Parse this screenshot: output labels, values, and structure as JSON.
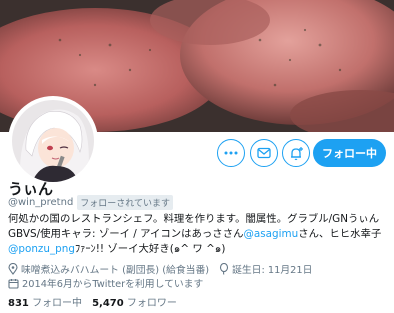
{
  "profile": {
    "display_name": "うぃん",
    "handle": "@win_pretnd",
    "follows_you_badge": "フォローされています",
    "follow_button_label": "フォロー中",
    "bio": {
      "line1": "何処かの国のレストランシェフ。料理を作ります。闇属性。グラブル/GNうぃん",
      "line2_pre": "GBVS/使用キャラ: ゾーイ / アイコンはあっささん",
      "line2_link": "@asagimu",
      "line2_post": "さん、ヒヒ水幸子",
      "line3_link": "@ponzu_png",
      "line3_post": "ﾌｧｰﾝ!! ゾーイ大好き(๑^ ワ ^๑)"
    },
    "location": "味噌煮込みバハムート (副団長) (給食当番)",
    "birthday": "誕生日: 11月21日",
    "joined": "2014年6月からTwitterを利用しています",
    "following_count": "831",
    "following_label": "フォロー中",
    "followers_count": "5,470",
    "followers_label": "フォロワー"
  },
  "icons": {
    "more": "more-dots-icon",
    "message": "envelope-icon",
    "notify": "bell-plus-icon",
    "location": "location-pin-icon",
    "birthday": "balloon-icon",
    "joined": "calendar-icon"
  },
  "colors": {
    "accent": "#1da1f2",
    "muted": "#657786",
    "text": "#14171a"
  }
}
